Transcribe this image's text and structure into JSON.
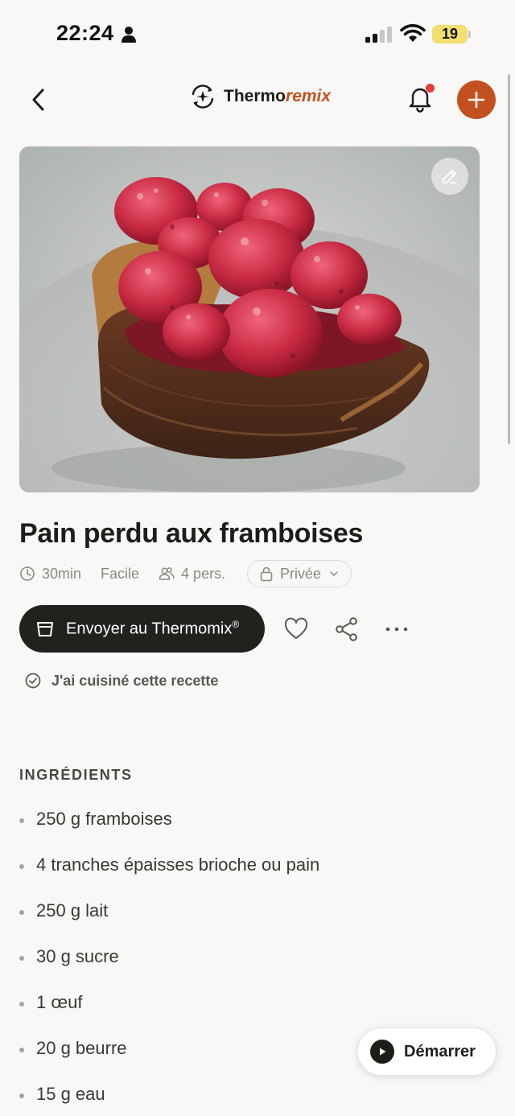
{
  "status_bar": {
    "time": "22:24",
    "battery_level": "19",
    "icons": [
      "person-icon",
      "signal-icon",
      "wifi-icon",
      "battery-icon"
    ]
  },
  "header": {
    "brand_main": "Thermo",
    "brand_accent": "remix",
    "icons": [
      "back-chevron-icon",
      "thermoremix-logo-icon",
      "bell-icon",
      "plus-icon"
    ],
    "notification_dot": true
  },
  "hero": {
    "icons": [
      "pencil-icon"
    ]
  },
  "recipe": {
    "title": "Pain perdu aux framboises",
    "duration": "30min",
    "difficulty": "Facile",
    "servings": "4 pers.",
    "visibility": "Privée"
  },
  "actions": {
    "send_label": "Envoyer au Thermomix",
    "send_label_mark": "®",
    "cooked_label": "J'ai cuisiné cette recette",
    "icons": [
      "thermomix-icon",
      "heart-icon",
      "share-icon",
      "more-icon",
      "check-circle-icon"
    ]
  },
  "ingredients": {
    "heading": "INGRÉDIENTS",
    "items": [
      "250 g framboises",
      "4 tranches épaisses brioche ou pain",
      "250 g lait",
      "30 g sucre",
      "1 œuf",
      "20 g beurre",
      "15 g eau"
    ]
  },
  "start_button": {
    "label": "Démarrer"
  },
  "colors": {
    "background": "#f9f8f6",
    "accent": "#c4501f",
    "dark_button": "#23211e",
    "notification": "#e53b3b",
    "battery": "#f2df6f"
  }
}
